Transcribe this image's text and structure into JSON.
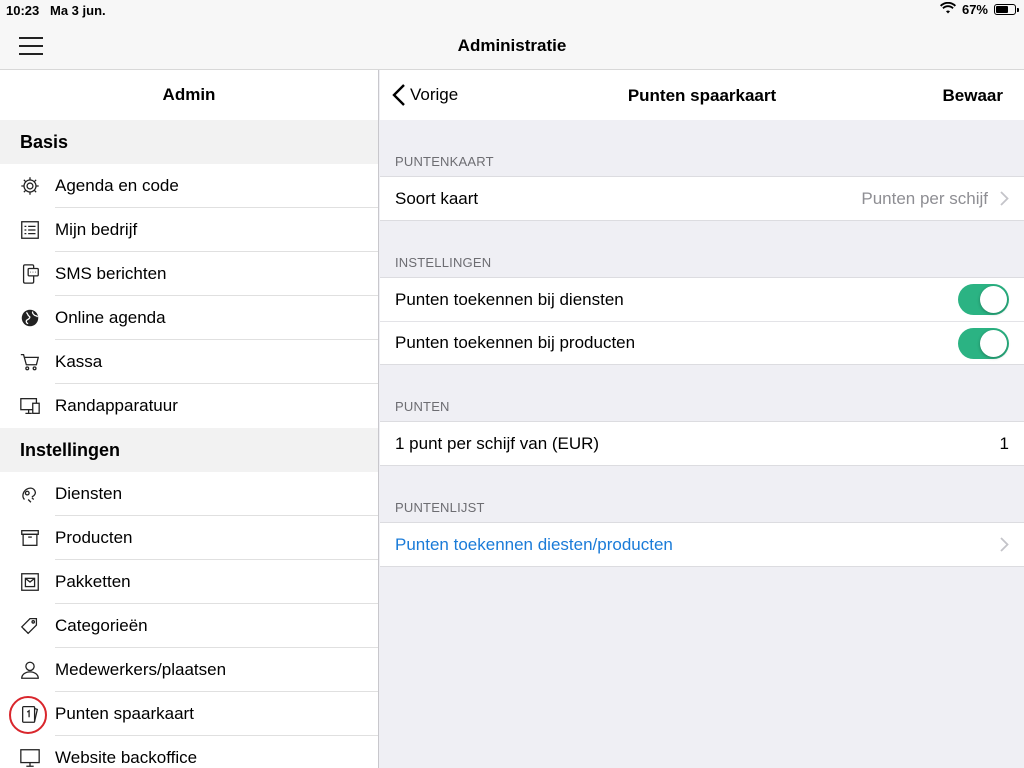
{
  "status_bar": {
    "time": "10:23",
    "date": "Ma 3 jun.",
    "battery_text": "67%",
    "battery_level": 0.67
  },
  "top_nav": {
    "title": "Administratie"
  },
  "master": {
    "header": "Admin",
    "sections": [
      {
        "title": "Basis",
        "items": [
          {
            "label": "Agenda en code",
            "icon": "gear-icon"
          },
          {
            "label": "Mijn bedrijf",
            "icon": "list-icon"
          },
          {
            "label": "SMS berichten",
            "icon": "phone-message-icon"
          },
          {
            "label": "Online agenda",
            "icon": "globe-icon"
          },
          {
            "label": "Kassa",
            "icon": "cart-icon"
          },
          {
            "label": "Randapparatuur",
            "icon": "devices-icon"
          }
        ]
      },
      {
        "title": "Instellingen",
        "items": [
          {
            "label": "Diensten",
            "icon": "services-icon"
          },
          {
            "label": "Producten",
            "icon": "box-icon"
          },
          {
            "label": "Pakketten",
            "icon": "package-icon"
          },
          {
            "label": "Categorieën",
            "icon": "tags-icon"
          },
          {
            "label": "Medewerkers/plaatsen",
            "icon": "person-icon"
          },
          {
            "label": "Punten spaarkaart",
            "icon": "loyalty-card-icon"
          },
          {
            "label": "Website backoffice",
            "icon": "monitor-icon"
          }
        ]
      }
    ]
  },
  "detail": {
    "back_label": "Vorige",
    "title": "Punten spaarkaart",
    "save_label": "Bewaar",
    "groups": [
      {
        "label": "PUNTENKAART",
        "rows": [
          {
            "label": "Soort kaart",
            "value": "Punten per schijf"
          }
        ]
      },
      {
        "label": "INSTELLINGEN",
        "rows": [
          {
            "label": "Punten toekennen bij diensten",
            "toggle_on": true
          },
          {
            "label": "Punten toekennen bij producten",
            "toggle_on": true
          }
        ]
      },
      {
        "label": "PUNTEN",
        "rows": [
          {
            "label": "1 punt per schijf van (EUR)",
            "value": "1"
          }
        ]
      },
      {
        "label": "PUNTENLIJST",
        "rows": [
          {
            "label": "Punten toekennen diesten/producten"
          }
        ]
      }
    ]
  },
  "colors": {
    "toggle_on": "#2bb383",
    "link": "#1a7bd8",
    "highlight_ring": "#d9262c"
  }
}
